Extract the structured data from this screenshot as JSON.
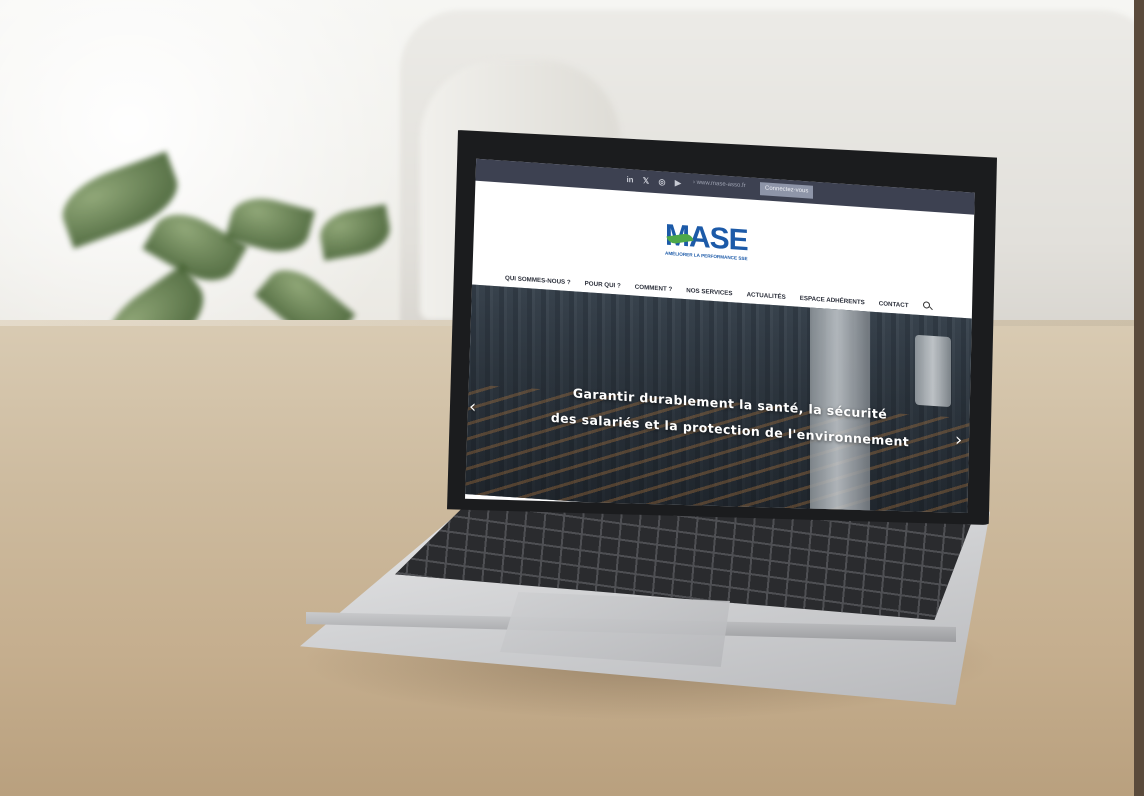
{
  "topbar": {
    "social_icons": [
      "linkedin-icon",
      "twitter-icon",
      "instagram-icon",
      "youtube-icon"
    ],
    "social_glyphs": [
      "in",
      "𝕏",
      "◎",
      "▶"
    ],
    "site_link": "› www.mase-asso.fr",
    "login_button": "Connectez-vous"
  },
  "logo": {
    "word": "MASE",
    "tagline": "AMÉLIORER LA PERFORMANCE SSE",
    "brand_color": "#1c5aa8",
    "accent_color": "#4ea84a"
  },
  "nav": {
    "items": [
      "QUI SOMMES-NOUS ?",
      "POUR QUI ?",
      "COMMENT ?",
      "NOS SERVICES",
      "ACTUALITÉS",
      "ESPACE ADHÉRENTS",
      "CONTACT"
    ]
  },
  "hero": {
    "line1": "Garantir durablement la santé, la sécurité",
    "line2": "des salariés et la protection de l'environnement",
    "prev_arrow": "‹",
    "next_arrow": "›"
  }
}
